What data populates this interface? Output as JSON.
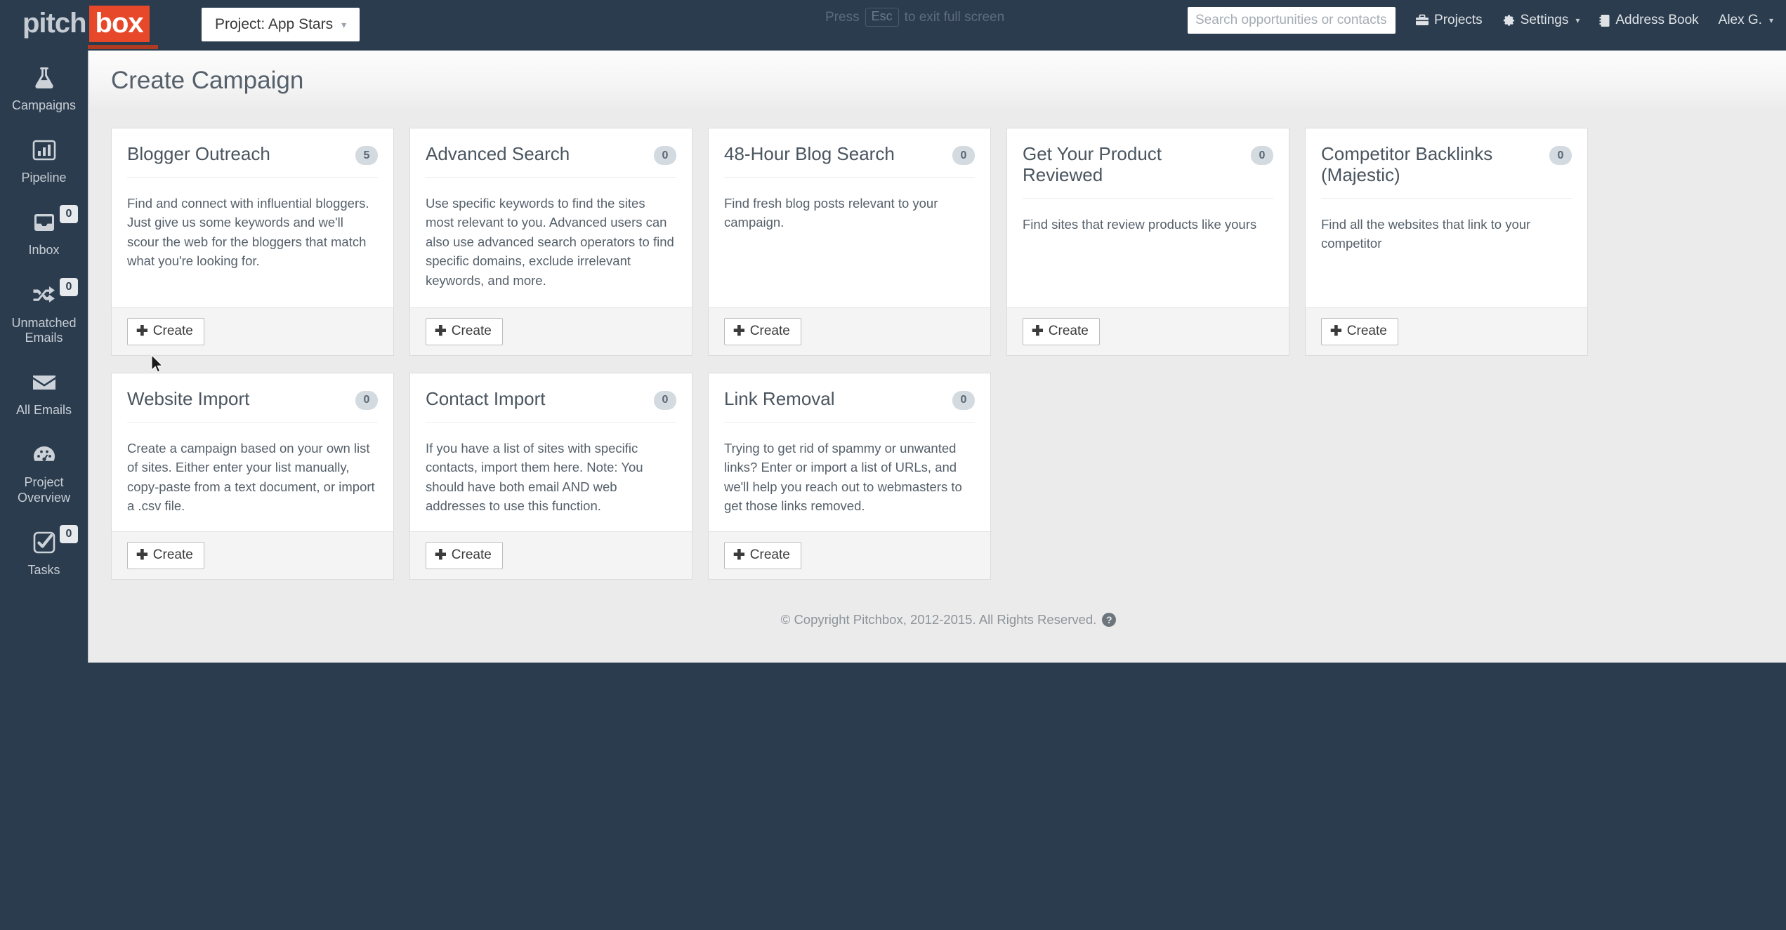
{
  "brand": {
    "logo_primary": "pitch",
    "logo_accent": "box",
    "accent_color": "#e8482a"
  },
  "topbar": {
    "project_button": {
      "label": "Project: App Stars",
      "caret": "▾"
    },
    "fullscreen_hint": {
      "prefix": "Press",
      "key": "Esc",
      "suffix": "to exit full screen"
    },
    "search": {
      "placeholder": "Search opportunities or contacts",
      "value": ""
    },
    "nav_items": [
      {
        "label": "Projects",
        "icon": "briefcase-icon",
        "has_caret": false
      },
      {
        "label": "Settings",
        "icon": "gear-icon",
        "has_caret": true
      },
      {
        "label": "Address Book",
        "icon": "book-icon",
        "has_caret": false
      },
      {
        "label": "Alex G.",
        "icon": "",
        "has_caret": true
      }
    ]
  },
  "sidebar": {
    "items": [
      {
        "label": "Campaigns",
        "icon": "flask-icon",
        "badge": null
      },
      {
        "label": "Pipeline",
        "icon": "bar-chart-icon",
        "badge": null
      },
      {
        "label": "Inbox",
        "icon": "inbox-icon",
        "badge": "0"
      },
      {
        "label": "Unmatched Emails",
        "icon": "shuffle-icon",
        "badge": "0"
      },
      {
        "label": "All Emails",
        "icon": "envelope-icon",
        "badge": null
      },
      {
        "label": "Project Overview",
        "icon": "dashboard-icon",
        "badge": null
      },
      {
        "label": "Tasks",
        "icon": "check-square-icon",
        "badge": "0"
      }
    ]
  },
  "page": {
    "title": "Create Campaign"
  },
  "cards": [
    {
      "title": "Blogger Outreach",
      "badge": "5",
      "description": "Find and connect with influential bloggers. Just give us some keywords and we'll scour the web for the bloggers that match what you're looking for.",
      "button": "Create"
    },
    {
      "title": "Advanced Search",
      "badge": "0",
      "description": "Use specific keywords to find the sites most relevant to you. Advanced users can also use advanced search operators to find specific domains, exclude irrelevant keywords, and more.",
      "button": "Create"
    },
    {
      "title": "48-Hour Blog Search",
      "badge": "0",
      "description": "Find fresh blog posts relevant to your campaign.",
      "button": "Create"
    },
    {
      "title": "Get Your Product Reviewed",
      "badge": "0",
      "description": "Find sites that review products like yours",
      "button": "Create"
    },
    {
      "title": "Competitor Backlinks (Majestic)",
      "badge": "0",
      "description": "Find all the websites that link to your competitor",
      "button": "Create"
    },
    {
      "title": "Website Import",
      "badge": "0",
      "description": "Create a campaign based on your own list of sites. Either enter your list manually, copy-paste from a text document, or import a .csv file.",
      "button": "Create"
    },
    {
      "title": "Contact Import",
      "badge": "0",
      "description": "If you have a list of sites with specific contacts, import them here. Note: You should have both email AND web addresses to use this function.",
      "button": "Create"
    },
    {
      "title": "Link Removal",
      "badge": "0",
      "description": "Trying to get rid of spammy or unwanted links? Enter or import a list of URLs, and we'll help you reach out to webmasters to get those links removed.",
      "button": "Create"
    }
  ],
  "footer": {
    "copyright": "© Copyright Pitchbox, 2012-2015. All Rights Reserved.",
    "help_glyph": "?"
  }
}
